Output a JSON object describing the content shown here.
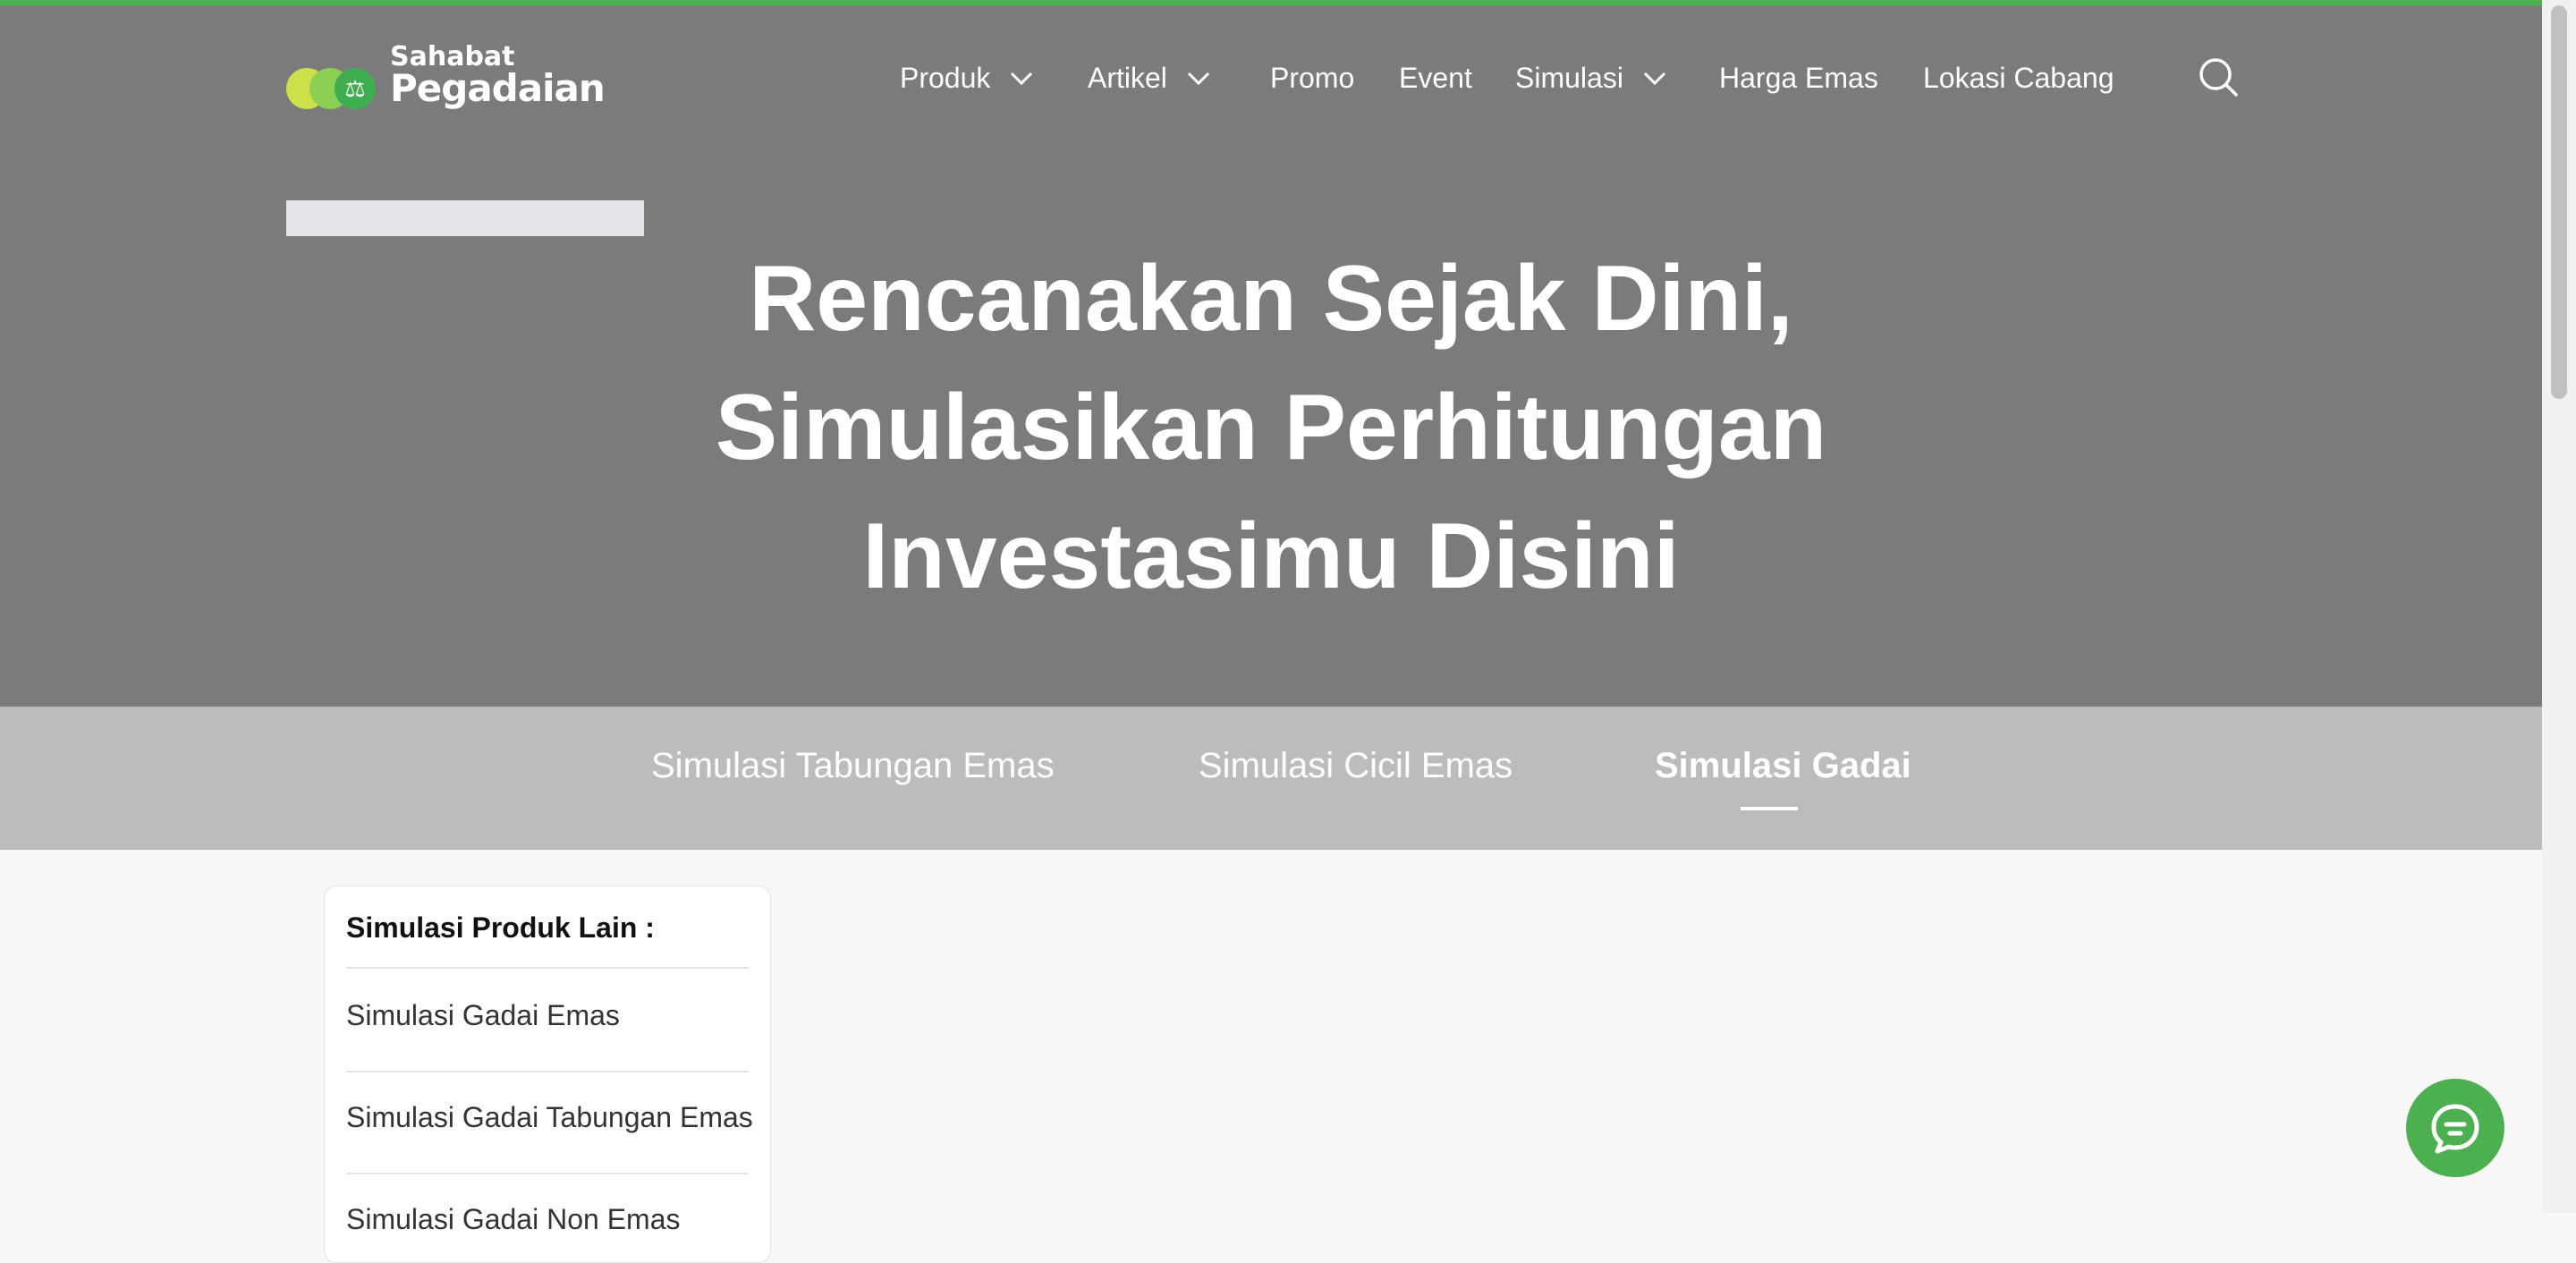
{
  "brand": {
    "small": "Sahabat",
    "big": "Pegadaian",
    "accent": "#4caf50"
  },
  "nav": {
    "items": [
      {
        "label": "Produk",
        "dropdown": true
      },
      {
        "label": "Artikel",
        "dropdown": true
      },
      {
        "label": "Promo",
        "dropdown": false
      },
      {
        "label": "Event",
        "dropdown": false
      },
      {
        "label": "Simulasi",
        "dropdown": true
      },
      {
        "label": "Harga Emas",
        "dropdown": false
      },
      {
        "label": "Lokasi Cabang",
        "dropdown": false
      }
    ],
    "search_icon": "search-icon"
  },
  "hero": {
    "lines": [
      "Rencanakan Sejak Dini,",
      "Simulasikan Perhitungan",
      "Investasimu Disini"
    ]
  },
  "tabs": [
    {
      "label": "Simulasi Tabungan Emas",
      "active": false
    },
    {
      "label": "Simulasi Cicil Emas",
      "active": false
    },
    {
      "label": "Simulasi Gadai",
      "active": true
    }
  ],
  "sidebar": {
    "title": "Simulasi Produk Lain :",
    "items": [
      "Simulasi Gadai Emas",
      "Simulasi Gadai Tabungan Emas",
      "Simulasi Gadai Non Emas"
    ]
  },
  "chat": {
    "icon": "chat-icon"
  }
}
